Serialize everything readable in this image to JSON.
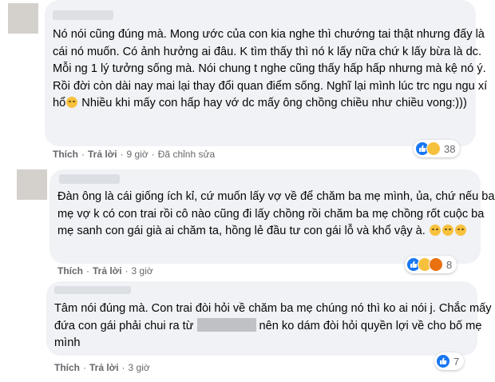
{
  "colors": {
    "bubble": "#f0f2f5",
    "meta": "#65676b",
    "like": "#1877f2",
    "haha": "#f7c13e",
    "angry": "#e9710f"
  },
  "comments": [
    {
      "lines": [
        "Nó nói cũng đúng mà. Mong ước của con kia nghe thì chướng tai",
        "thật nhưng đấy là cái nó muốn. Có ảnh hưởng ai đâu. K tìm thấy thì",
        "nó k lấy nữa chứ k lấy bừa là dc. Mỗi ng 1 lý tưởng sống mà. Nói",
        "chung t nghe cũng thấy hấp hấp nhưng mà kệ nó ý. Rồi đời còn dài",
        "nay mai lại thay đổi quan điểm sống. Nghĩ lại mình lúc trc ngu ngu xí",
        "Nhiều khi mấy con hấp hay vớ dc mấy ông chồng chiều như",
        "chiều vong:)))"
      ],
      "line5_prefix": "hổ",
      "actions": {
        "like": "Thích",
        "reply": "Trả lời",
        "time": "9 giờ",
        "edited": "Đã chỉnh sửa"
      },
      "reactions": {
        "icons": [
          "like-icon",
          "haha-icon"
        ],
        "count": "38"
      }
    },
    {
      "lines": [
        "Đàn ông là cái giống ích kỉ, cứ muốn lấy vợ về để chăm ba mẹ mình,",
        "ủa, chứ nếu ba mẹ vợ k có con trai rồi cô nào cũng đi lấy chồng rồi",
        "chăm ba mẹ chồng rốt cuộc ba mẹ sanh con gái già ai chăm ta, hồng",
        "lẻ đầu tư con gái lỗ và khổ vậy à."
      ],
      "actions": {
        "like": "Thích",
        "reply": "Trả lời",
        "time": "3 giờ"
      },
      "reactions": {
        "icons": [
          "like-icon",
          "wow-icon",
          "angry-icon"
        ],
        "count": "8"
      }
    },
    {
      "lines": [
        "Tâm nói đúng mà. Con trai đòi hỏi về chăm ba mẹ chúng nó thì ko ai",
        "nói j. Chắc mấy đứa con gái phải chui ra từ",
        "nên ko dám đòi hỏi",
        "quyền lợi về cho bố mẹ mình"
      ],
      "actions": {
        "like": "Thích",
        "reply": "Trả lời",
        "time": "3 giờ"
      },
      "reactions": {
        "icons": [
          "like-icon"
        ],
        "count": "7"
      }
    }
  ]
}
